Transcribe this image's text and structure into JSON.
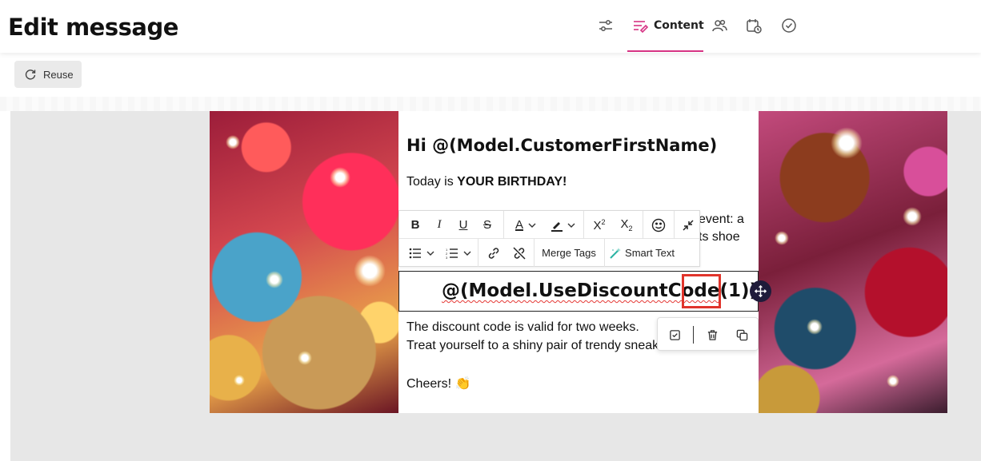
{
  "header": {
    "title": "Edit message",
    "tabs": [
      {
        "icon": "sliders-icon"
      },
      {
        "icon": "content-icon",
        "label": "Content",
        "active": true
      },
      {
        "icon": "users-icon"
      },
      {
        "icon": "calendar-clock-icon"
      },
      {
        "icon": "check-circle-icon"
      }
    ],
    "accent": "#d63384"
  },
  "toolbar": {
    "reuse_label": "Reuse"
  },
  "email": {
    "greeting": "Hi @(Model.CustomerFirstName)",
    "line1_prefix": "Today is ",
    "line1_bold": "YOUR BIRTHDAY!",
    "line2_fragment": "event: a",
    "line3_fragment": "ts shoe",
    "discount_code": "@(Model.UseDiscountCode(1))",
    "discount_code_main": "@(Model.UseDiscountCode",
    "discount_code_arg": "(1))",
    "valid_line": "The discount code is valid for two weeks.",
    "treat_line": "Treat yourself to a shiny pair of trendy sneak",
    "signoff": "Cheers!",
    "signoff_emoji": "👏"
  },
  "rte": {
    "bold": "B",
    "italic": "I",
    "underline": "U",
    "strike": "S",
    "font_color": "A",
    "merge_tags": "Merge Tags",
    "smart_text": "Smart Text"
  },
  "highlight_color": "#e0342b"
}
